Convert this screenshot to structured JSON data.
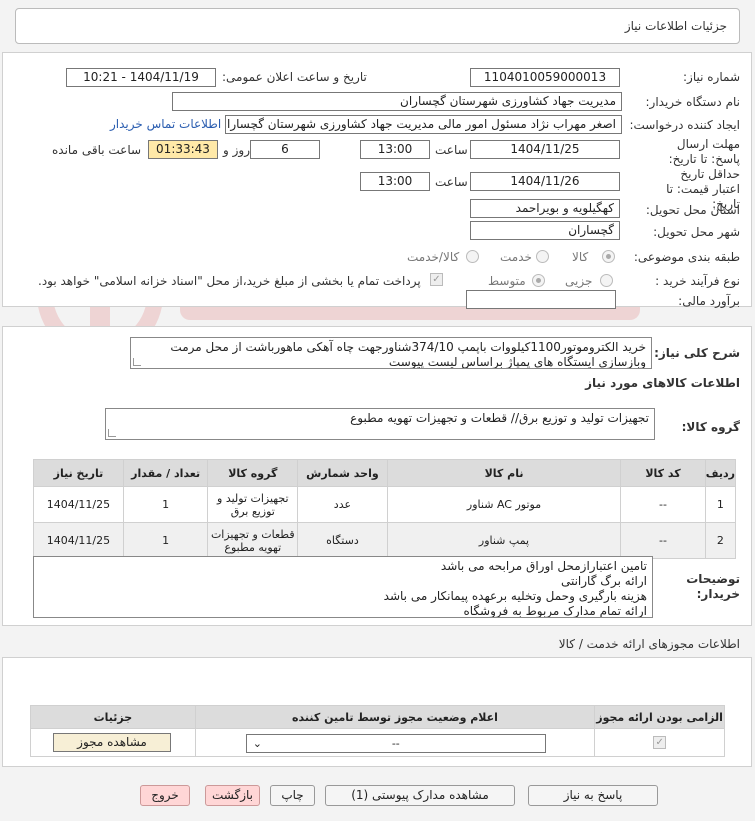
{
  "header": {
    "title": "جزئیات اطلاعات نیاز"
  },
  "form": {
    "need_number_label": "شماره نیاز:",
    "need_number": "1104010059000013",
    "announce_label": "تاریخ و ساعت اعلان عمومی:",
    "announce_value": "1404/11/19 - 10:21",
    "buyer_org_label": "نام دستگاه خریدار:",
    "buyer_org": "مدیریت جهاد کشاورزی شهرستان گچساران",
    "requester_label": "ایجاد کننده درخواست:",
    "requester": "اصغر مهراب نژاد مسئول امور مالی مدیریت جهاد کشاورزی شهرستان گچساران",
    "contact_link": "اطلاعات تماس خریدار",
    "deadline_label": "مهلت ارسال پاسخ: تا تاریخ:",
    "deadline_date": "1404/11/25",
    "time_label": "ساعت",
    "deadline_time": "13:00",
    "days_value": "6",
    "days_label": "روز و",
    "remaining_time": "01:33:43",
    "remaining_label": "ساعت باقی مانده",
    "validity_label": "حداقل تاریخ اعتبار قیمت: تا تاریخ:",
    "validity_date": "1404/11/26",
    "validity_time": "13:00",
    "province_label": "استان محل تحویل:",
    "province": "کهگیلویه و بویراحمد",
    "city_label": "شهر محل تحویل:",
    "city": "گچساران",
    "category_label": "طبقه بندی موضوعی:",
    "category_options": [
      "کالا",
      "خدمت",
      "کالا/خدمت"
    ],
    "process_label": "نوع فرآیند خرید :",
    "process_options": [
      "جزیی",
      "متوسط"
    ],
    "payment_note": "پرداخت تمام یا بخشی از مبلغ خرید،از محل \"اسناد خزانه اسلامی\" خواهد بود.",
    "estimate_label": "برآورد مالی:",
    "estimate_value": ""
  },
  "description": {
    "label": "شرح کلی نیاز:",
    "text": "خرید الکتروموتور1100کیلووات باپمپ 374/10شناورجهت چاه آهکی ماهورباشت از محل مرمت وبازسازی ایستگاه های پمپاژ  براساس لیست پیوست"
  },
  "goods": {
    "section_title": "اطلاعات کالاهای مورد نیاز",
    "group_label": "گروه کالا:",
    "group_value": "تجهیزات تولید و توزیع برق// قطعات و تجهیزات تهویه مطبوع",
    "table_headers": [
      "ردیف",
      "کد کالا",
      "نام کالا",
      "واحد شمارش",
      "گروه کالا",
      "تعداد / مقدار",
      "تاریخ نیاز"
    ],
    "rows": [
      [
        "1",
        "--",
        "موتور AC شناور",
        "عدد",
        "تجهیزات تولید و توزیع برق",
        "1",
        "1404/11/25"
      ],
      [
        "2",
        "--",
        "پمپ شناور",
        "دستگاه",
        "قطعات و تجهیزات تهویه مطبوع",
        "1",
        "1404/11/25"
      ]
    ]
  },
  "buyer_notes": {
    "label": "توضیحات خریدار:",
    "lines": [
      "تامین اعتبارازمحل اوراق مرابحه می باشد",
      "ارائه برگ گارانتی",
      "هزینه بارگیری وحمل وتخلیه برعهده پیمانکار می باشد",
      "ارائه تمام مدارک مربوط به فروشگاه"
    ]
  },
  "permits": {
    "title": "اطلاعات مجوزهای ارائه خدمت / کالا",
    "headers": [
      "الزامی بودن ارائه مجوز",
      "اعلام وضعیت مجوز توسط تامین کننده",
      "جزئیات"
    ],
    "select_value": "--",
    "view_button": "مشاهده مجوز"
  },
  "buttons": {
    "reply": "پاسخ به نیاز",
    "attachments": "مشاهده مدارک پیوستی (1)",
    "print": "چاپ",
    "back": "بازگشت",
    "exit": "خروج"
  },
  "colors": {
    "yellow_field": "#ffe9a8",
    "pink_button": "#ffd6d6",
    "link": "#2a5db0"
  }
}
